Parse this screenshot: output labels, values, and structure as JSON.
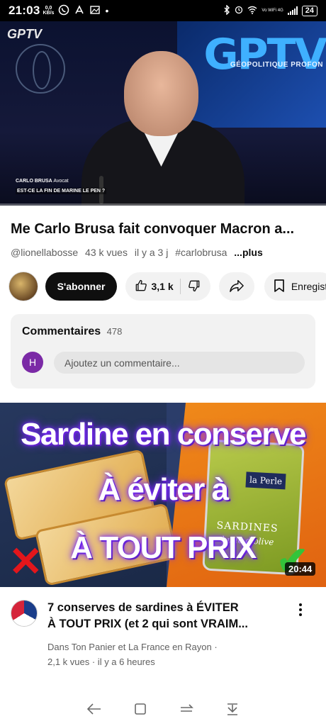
{
  "status_bar": {
    "time": "21:03",
    "net_speed_value": "0,0",
    "net_speed_unit": "KB/s",
    "battery": "24",
    "wifi_label": "Vo WiFi 4G"
  },
  "player": {
    "channel_logo": "GPTV",
    "bg_logo": "GPTV",
    "bg_tagline": "GÉOPOLITIQUE PROFON",
    "lower_third_name": "CARLO BRUSA",
    "lower_third_role": "Avocat",
    "lower_third_question": "EST-CE LA FIN DE MARINE LE PEN ?",
    "progress_fraction": 0.0
  },
  "video": {
    "title": "Me Carlo Brusa fait convoquer Macron a...",
    "channel_handle": "@lionellabosse",
    "views": "43 k vues",
    "age": "il y a 3 j",
    "hashtag": "#carlobrusa",
    "more": "...plus"
  },
  "actions": {
    "subscribe": "S'abonner",
    "likes": "3,1 k",
    "save": "Enregistrer"
  },
  "comments": {
    "label": "Commentaires",
    "count": "478",
    "user_initial": "H",
    "placeholder": "Ajoutez un commentaire..."
  },
  "next_video": {
    "thumb_line1": "Sardine en conserve",
    "thumb_line2": "À éviter à",
    "thumb_line3": "À TOUT PRIX",
    "can_brand": "la Perle",
    "can_label": "SARDINES",
    "can_sub": "huile d'olive",
    "duration": "20:44",
    "title_line1": "7 conserves de sardines à ÉVITER",
    "title_line2": "À TOUT PRIX (et 2 qui sont VRAIM...",
    "channel": "Dans Ton Panier et La France en Rayon ·",
    "stats": "2,1 k vues · il y a 6 heures"
  },
  "icons": {
    "like": "thumb-up-icon",
    "dislike": "thumb-down-icon",
    "share": "share-icon",
    "save": "bookmark-icon",
    "more": "more-vert-icon"
  },
  "colors": {
    "subscribe_bg": "#0f0f0f",
    "pill_bg": "#f2f2f2",
    "progress": "#ff0000",
    "user_avatar": "#7b2aa6"
  }
}
